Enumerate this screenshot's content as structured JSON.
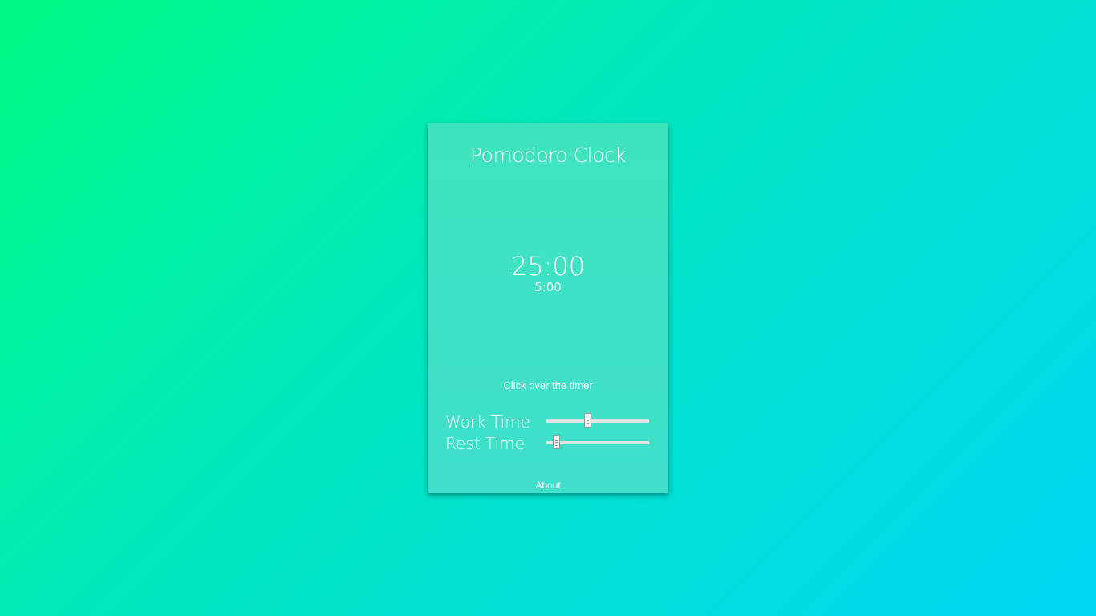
{
  "app": {
    "title": "Pomodoro Clock"
  },
  "timer": {
    "main": "25:00",
    "sub": "5:00"
  },
  "hint": "Click over the timer",
  "sliders": {
    "work": {
      "label": "Work Time",
      "fraction": 0.41
    },
    "rest": {
      "label": "Rest Time",
      "fraction": 0.1
    }
  },
  "footer": {
    "about_label": "About"
  },
  "colors": {
    "background_start": "#00fb84",
    "background_end": "#00d6f4",
    "card": "#3fe2c4",
    "text": "#ffffff"
  }
}
